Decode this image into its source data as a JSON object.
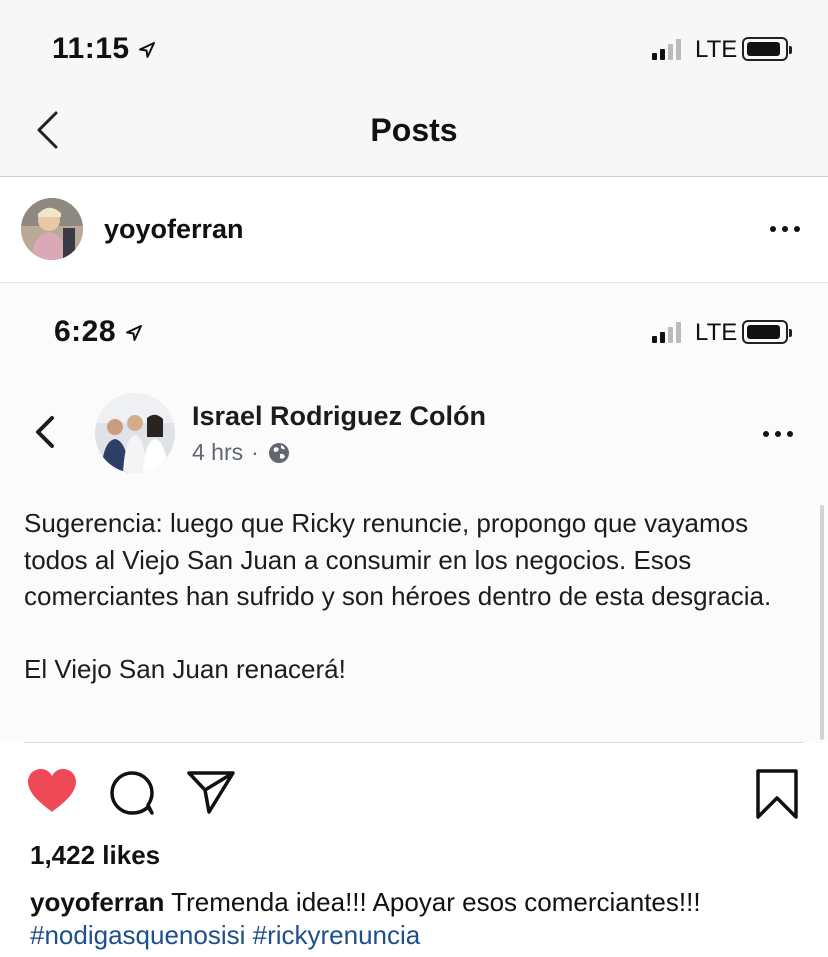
{
  "status_bar": {
    "time": "11:15",
    "network": "LTE"
  },
  "nav": {
    "title": "Posts"
  },
  "post": {
    "username": "yoyoferran",
    "likes": "1,422 likes",
    "caption": {
      "username": "yoyoferran",
      "text": "Tremenda idea!!! Apoyar esos comerciantes!!!",
      "hashtags": [
        "#nodigasquenosisi",
        "#rickyrenuncia"
      ]
    },
    "liked": true
  },
  "embedded_screenshot": {
    "status_bar": {
      "time": "6:28",
      "network": "LTE"
    },
    "author": "Israel Rodriguez Colón",
    "time_ago": "4 hrs",
    "separator": "·",
    "paragraphs": [
      "Sugerencia:  luego que Ricky renuncie, propongo que vayamos todos al Viejo San Juan a consumir en los negocios.  Esos comerciantes han sufrido y son héroes dentro de esta desgracia.",
      "El Viejo San Juan renacerá!"
    ]
  },
  "colors": {
    "heart": "#ed4956",
    "hashtag": "#1d4f8a",
    "bar_bg": "#f7f7f7"
  }
}
